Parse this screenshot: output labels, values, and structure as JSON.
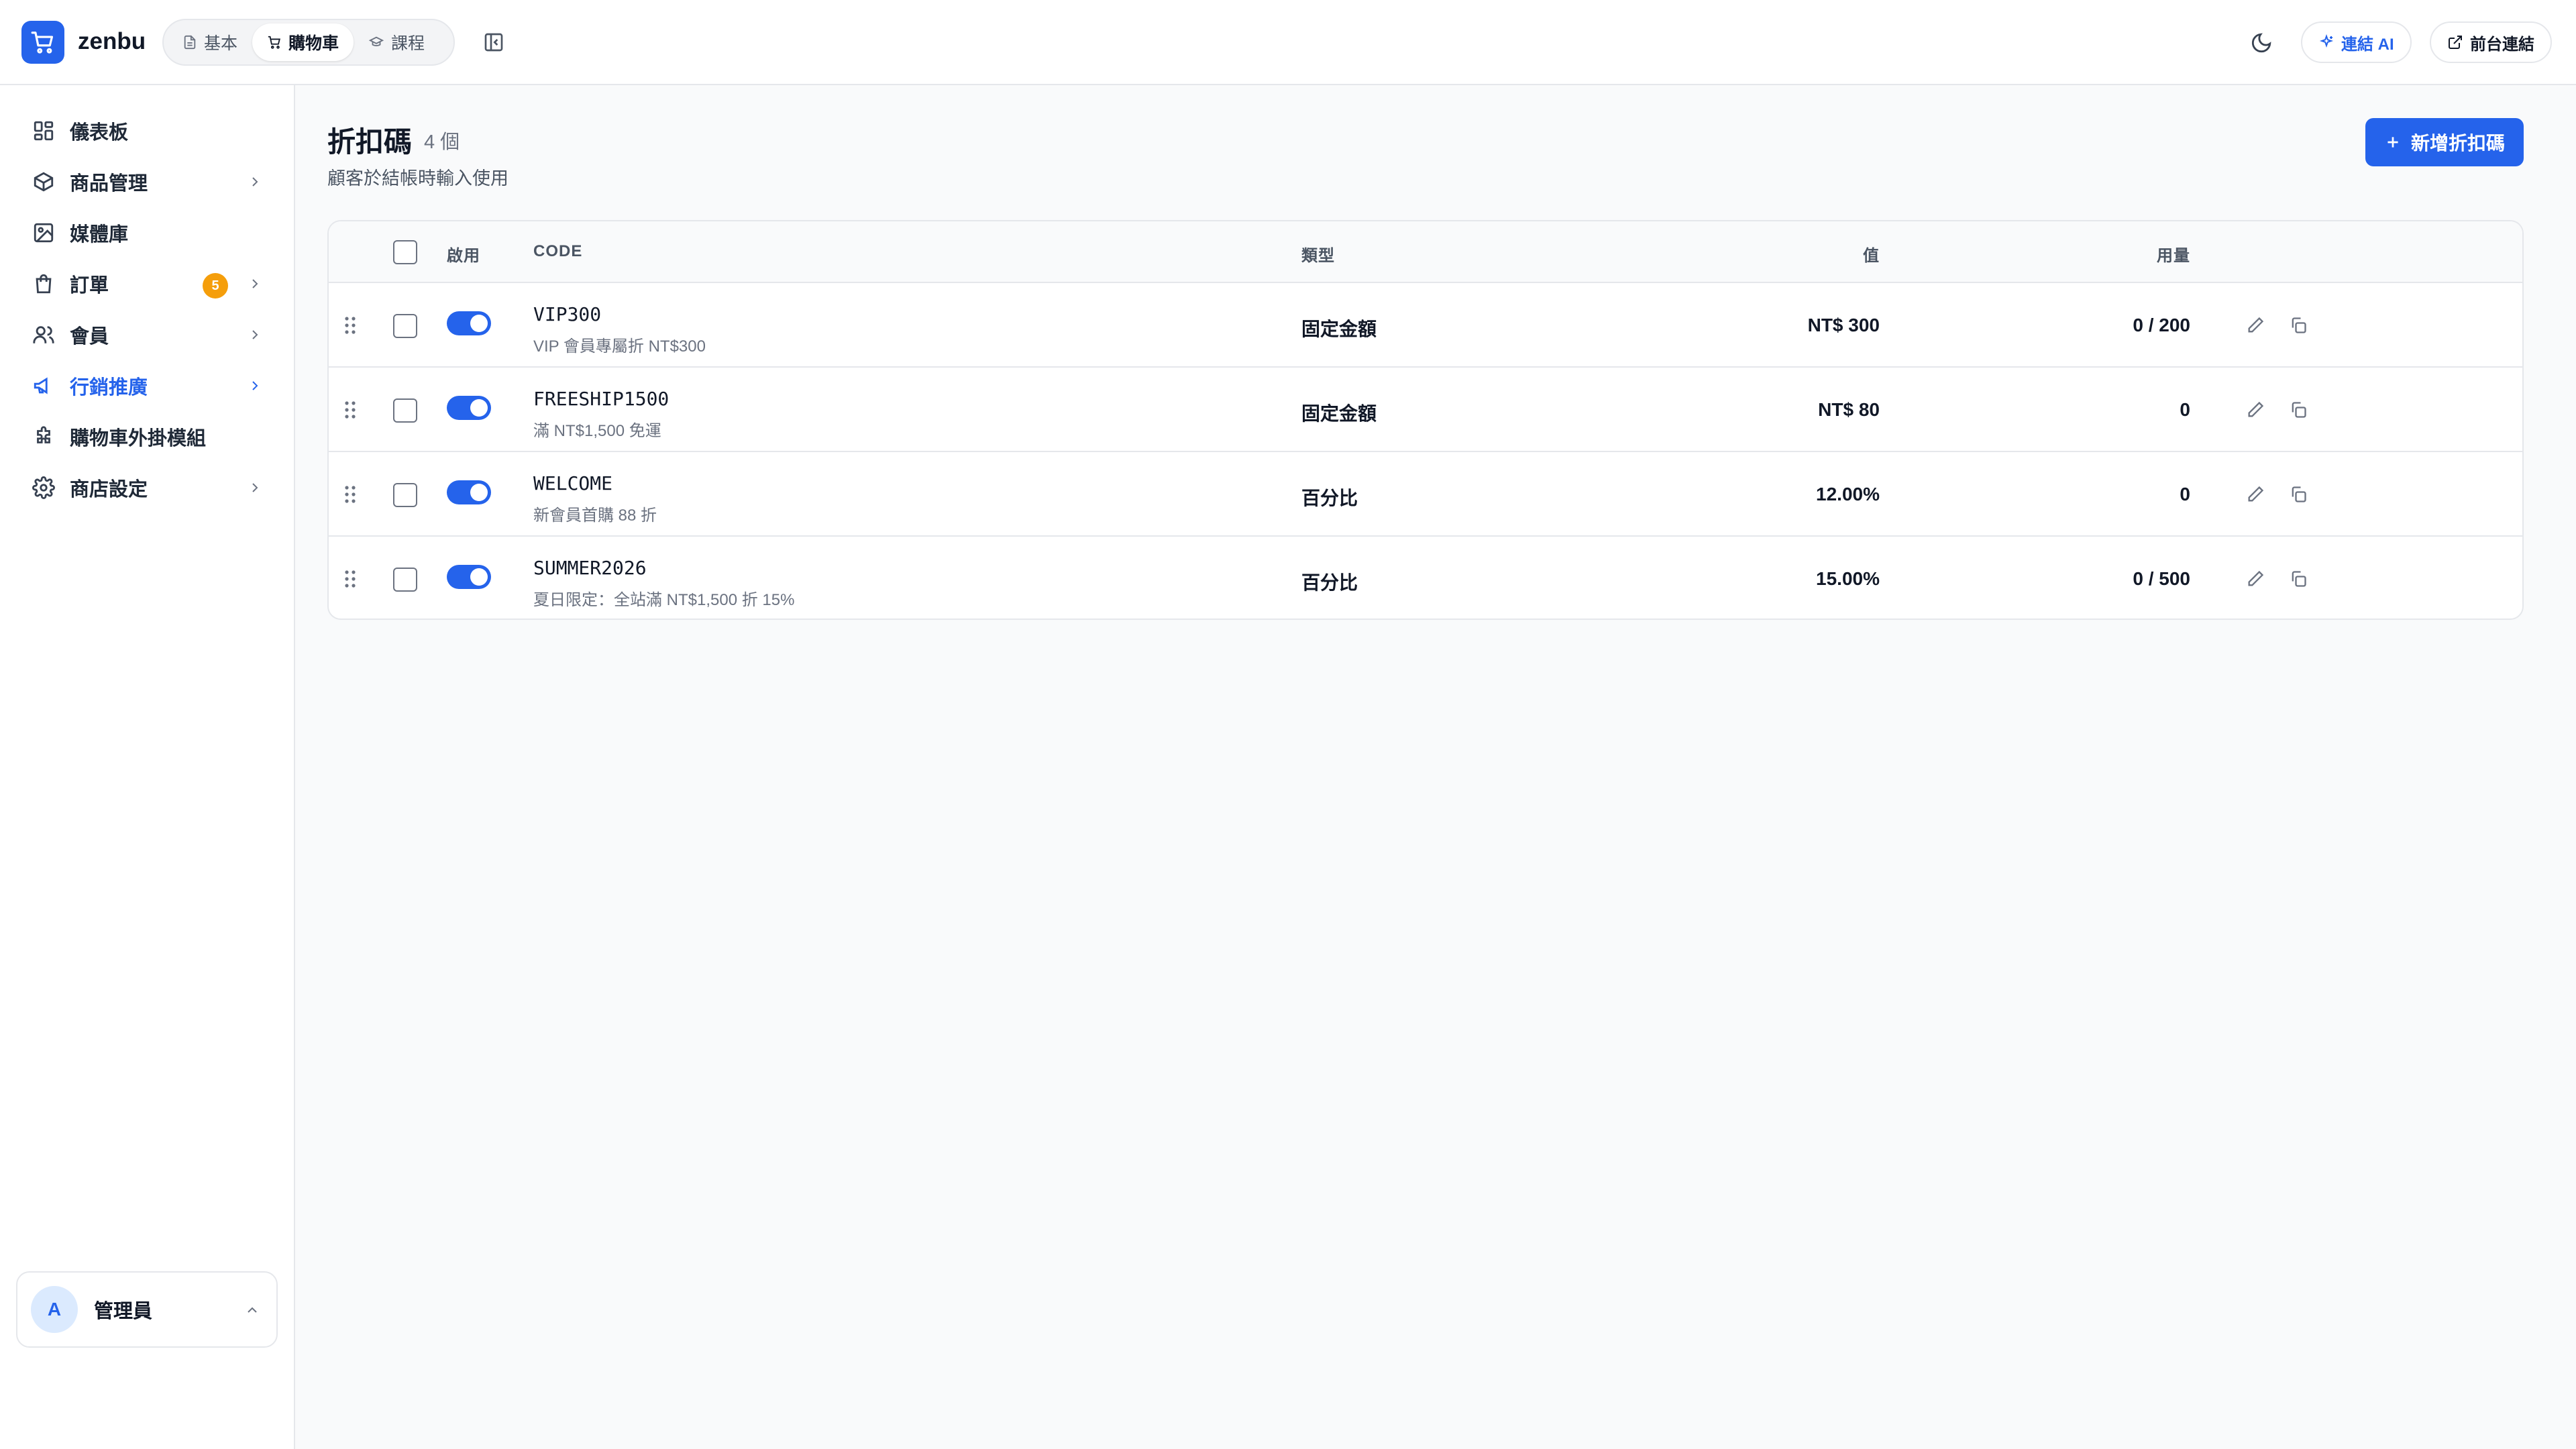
{
  "header": {
    "brand": "zenbu",
    "tabs": [
      {
        "label": "基本",
        "icon": "document-icon"
      },
      {
        "label": "購物車",
        "icon": "cart-icon"
      },
      {
        "label": "課程",
        "icon": "graduation-cap-icon"
      }
    ],
    "ai_button": "連結 AI",
    "front_button": "前台連結"
  },
  "sidebar": {
    "items": [
      {
        "label": "儀表板",
        "icon": "dashboard-icon"
      },
      {
        "label": "商品管理",
        "icon": "box-icon"
      },
      {
        "label": "媒體庫",
        "icon": "image-icon"
      },
      {
        "label": "訂單",
        "icon": "shopping-bag-icon",
        "badge": "5"
      },
      {
        "label": "會員",
        "icon": "users-icon"
      },
      {
        "label": "行銷推廣",
        "icon": "megaphone-icon"
      },
      {
        "label": "購物車外掛模組",
        "icon": "puzzle-icon"
      },
      {
        "label": "商店設定",
        "icon": "gear-icon"
      }
    ],
    "user": {
      "initial": "A",
      "name": "管理員"
    }
  },
  "main": {
    "title": "折扣碼",
    "count": "4 個",
    "subtitle": "顧客於結帳時輸入使用",
    "add_button": "新增折扣碼",
    "columns": {
      "enabled": "啟用",
      "code": "CODE",
      "type": "類型",
      "value": "值",
      "usage": "用量"
    },
    "rows": [
      {
        "code": "VIP300",
        "desc": "VIP 會員專屬折 NT$300",
        "type": "固定金額",
        "value": "NT$ 300",
        "usage": "0 / 200"
      },
      {
        "code": "FREESHIP1500",
        "desc": "滿 NT$1,500 免運",
        "type": "固定金額",
        "value": "NT$ 80",
        "usage": "0"
      },
      {
        "code": "WELCOME",
        "desc": "新會員首購 88 折",
        "type": "百分比",
        "value": "12.00%",
        "usage": "0"
      },
      {
        "code": "SUMMER2026",
        "desc": "夏日限定：全站滿 NT$1,500 折 15%",
        "type": "百分比",
        "value": "15.00%",
        "usage": "0 / 500"
      }
    ]
  },
  "colors": {
    "accent": "#2563eb",
    "badge": "#f59e0b"
  }
}
